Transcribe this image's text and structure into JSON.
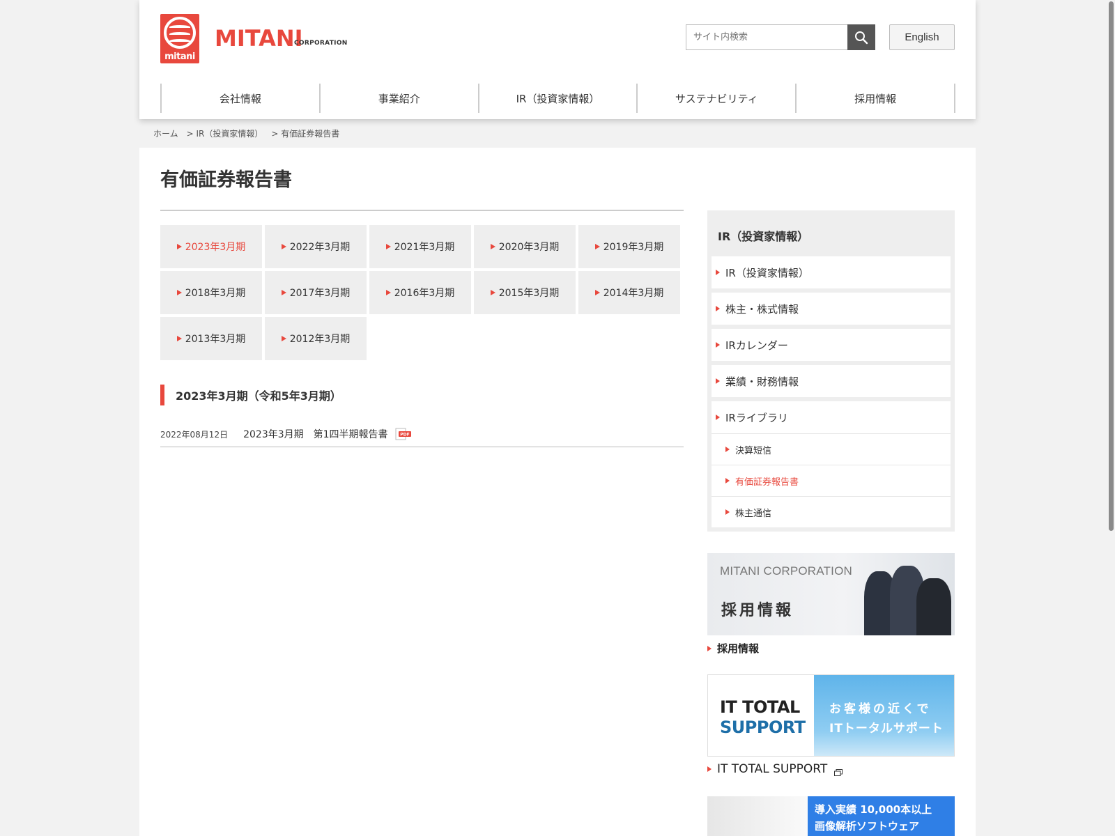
{
  "header": {
    "logo_mark_text": "mitani",
    "logo_word": "MITANI",
    "logo_sub": "CORPORATION",
    "search_placeholder": "サイト内検索",
    "lang_label": "English"
  },
  "gnav": [
    "会社情報",
    "事業紹介",
    "IR（投資家情報）",
    "サステナビリティ",
    "採用情報"
  ],
  "breadcrumb": [
    "ホーム",
    "> IR（投資家情報）",
    "> 有価証券報告書"
  ],
  "page_title": "有価証券報告書",
  "years": [
    {
      "label": "2023年3月期",
      "active": true
    },
    {
      "label": "2022年3月期",
      "active": false
    },
    {
      "label": "2021年3月期",
      "active": false
    },
    {
      "label": "2020年3月期",
      "active": false
    },
    {
      "label": "2019年3月期",
      "active": false
    },
    {
      "label": "2018年3月期",
      "active": false
    },
    {
      "label": "2017年3月期",
      "active": false
    },
    {
      "label": "2016年3月期",
      "active": false
    },
    {
      "label": "2015年3月期",
      "active": false
    },
    {
      "label": "2014年3月期",
      "active": false
    },
    {
      "label": "2013年3月期",
      "active": false
    },
    {
      "label": "2012年3月期",
      "active": false
    }
  ],
  "section": {
    "heading": "2023年3月期（令和5年3月期）",
    "documents": [
      {
        "date": "2022年08月12日",
        "title": "2023年3月期　第1四半期報告書",
        "icon": "pdf-icon",
        "icon_text": "PDF"
      }
    ]
  },
  "side_nav": {
    "title": "IR（投資家情報）",
    "items": [
      "IR（投資家情報）",
      "株主・株式情報",
      "IRカレンダー",
      "業績・財務情報",
      "IRライブラリ"
    ],
    "sub_items": [
      {
        "label": "決算短信",
        "active": false
      },
      {
        "label": "有価証券報告書",
        "active": true
      },
      {
        "label": "株主通信",
        "active": false
      }
    ]
  },
  "banners": {
    "recruit": {
      "corp": "MITANI CORPORATION",
      "big": "採用情報",
      "link": "採用情報"
    },
    "it": {
      "t1": "IT TOTAL",
      "t2": "SUPPORT",
      "r1": "お客様の近くで",
      "r2": "ITトータルサポート",
      "link": "IT TOTAL SUPPORT"
    },
    "image": {
      "l1": "導入実績 10,000本以上",
      "l2": "画像解析ソフトウェア"
    }
  },
  "colors": {
    "accent": "#e8483d",
    "nav_bg": "#eeeeee",
    "search_button": "#555555"
  }
}
